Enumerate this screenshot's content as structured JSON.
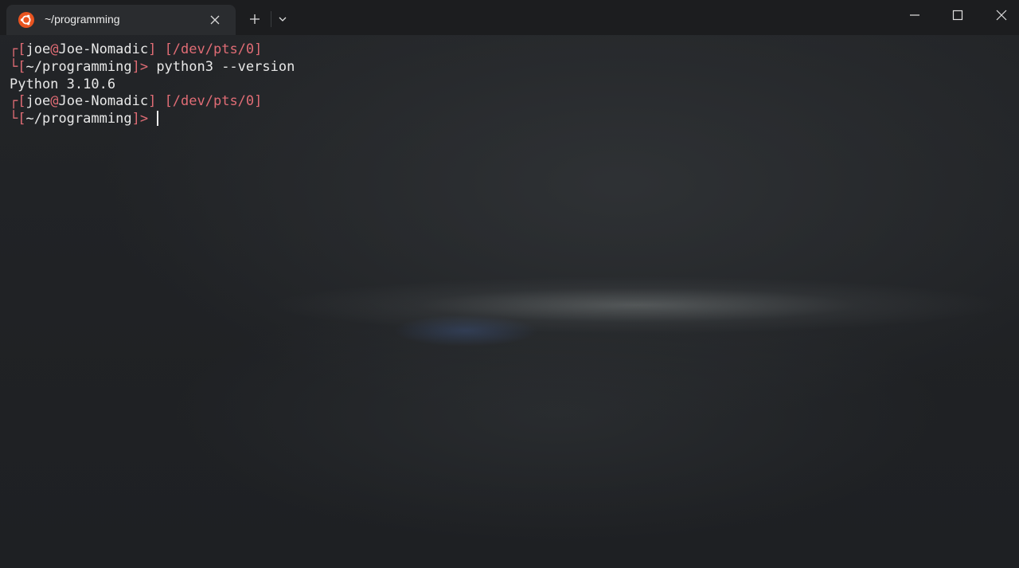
{
  "window": {
    "tab_title": "~/programming",
    "tab_icon": "ubuntu-icon",
    "accent": "#e95420",
    "controls": [
      "minimize-icon",
      "maximize-icon",
      "close-icon"
    ]
  },
  "prompt": {
    "corner_top": "┌",
    "corner_bottom": "└",
    "open": "[",
    "close": "]",
    "user": "joe",
    "at": "@",
    "host": "Joe-Nomadic",
    "tty": "[/dev/pts/0]",
    "cwd": "~/programming",
    "arrow": ">",
    "color": "#e06c75"
  },
  "session": {
    "command": "python3 --version",
    "output": "Python 3.10.6"
  }
}
